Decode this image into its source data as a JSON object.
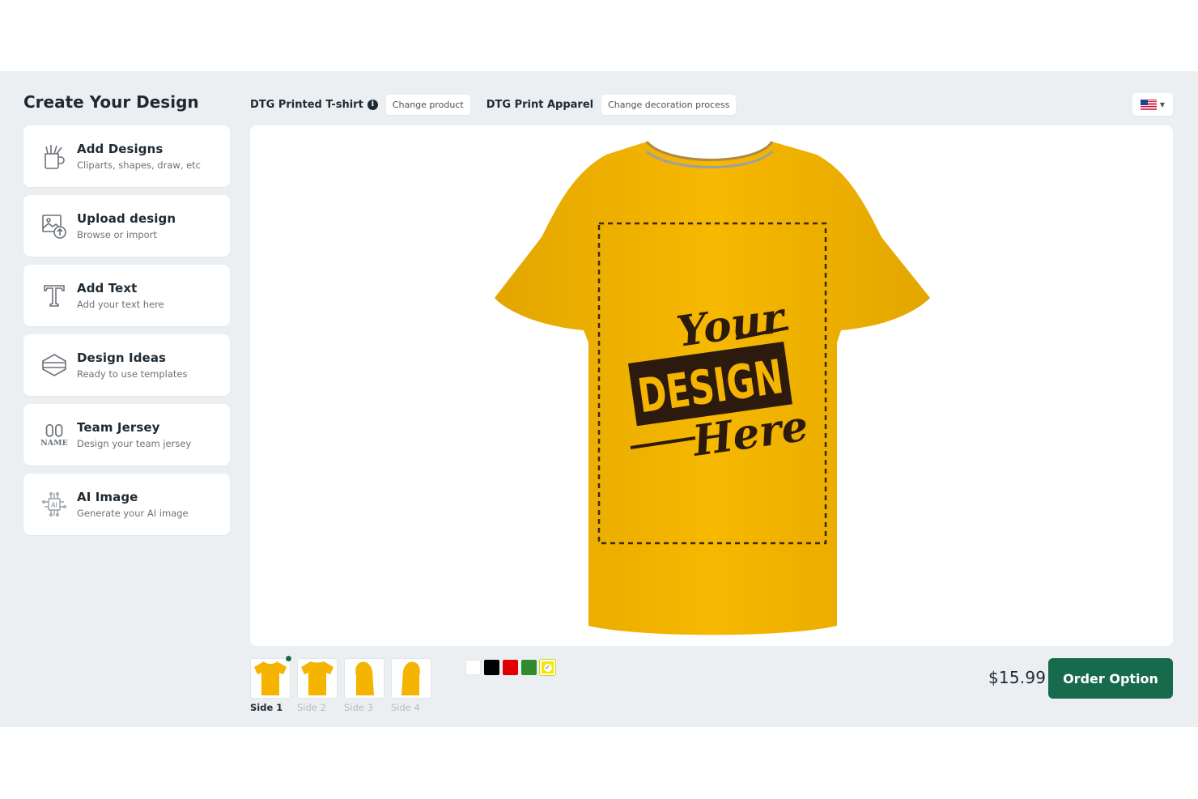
{
  "panel": {
    "title": "Create Your Design"
  },
  "tools": [
    {
      "title": "Add Designs",
      "subtitle": "Cliparts, shapes, draw, etc",
      "icon": "clipart-cup-icon"
    },
    {
      "title": "Upload design",
      "subtitle": "Browse or import",
      "icon": "upload-image-icon"
    },
    {
      "title": "Add Text",
      "subtitle": "Add your text here",
      "icon": "text-icon"
    },
    {
      "title": "Design Ideas",
      "subtitle": "Ready to use templates",
      "icon": "templates-icon"
    },
    {
      "title": "Team Jersey",
      "subtitle": "Design your team jersey",
      "icon": "jersey-number-icon",
      "icon_text": "NAME"
    },
    {
      "title": "AI Image",
      "subtitle": "Generate your AI image",
      "icon": "ai-chip-icon",
      "icon_text": "AI"
    }
  ],
  "topbar": {
    "product_name": "DTG Printed T-shirt",
    "change_product": "Change product",
    "process_name": "DTG Print Apparel",
    "change_process": "Change decoration process"
  },
  "design_placeholder": {
    "line1": "Your",
    "line2": "DESIGN",
    "line3": "Here"
  },
  "sides": [
    {
      "label": "Side 1",
      "active": true
    },
    {
      "label": "Side 2",
      "active": false
    },
    {
      "label": "Side 3",
      "active": false
    },
    {
      "label": "Side 4",
      "active": false
    }
  ],
  "colors": {
    "swatches": [
      "#ffffff",
      "#000000",
      "#e10000",
      "#2e8b2e",
      "#f4e600"
    ],
    "selected_index": 4,
    "shirt": "#f4b400",
    "accent": "#176b4c"
  },
  "price": "$15.99",
  "order_button": "Order Option"
}
